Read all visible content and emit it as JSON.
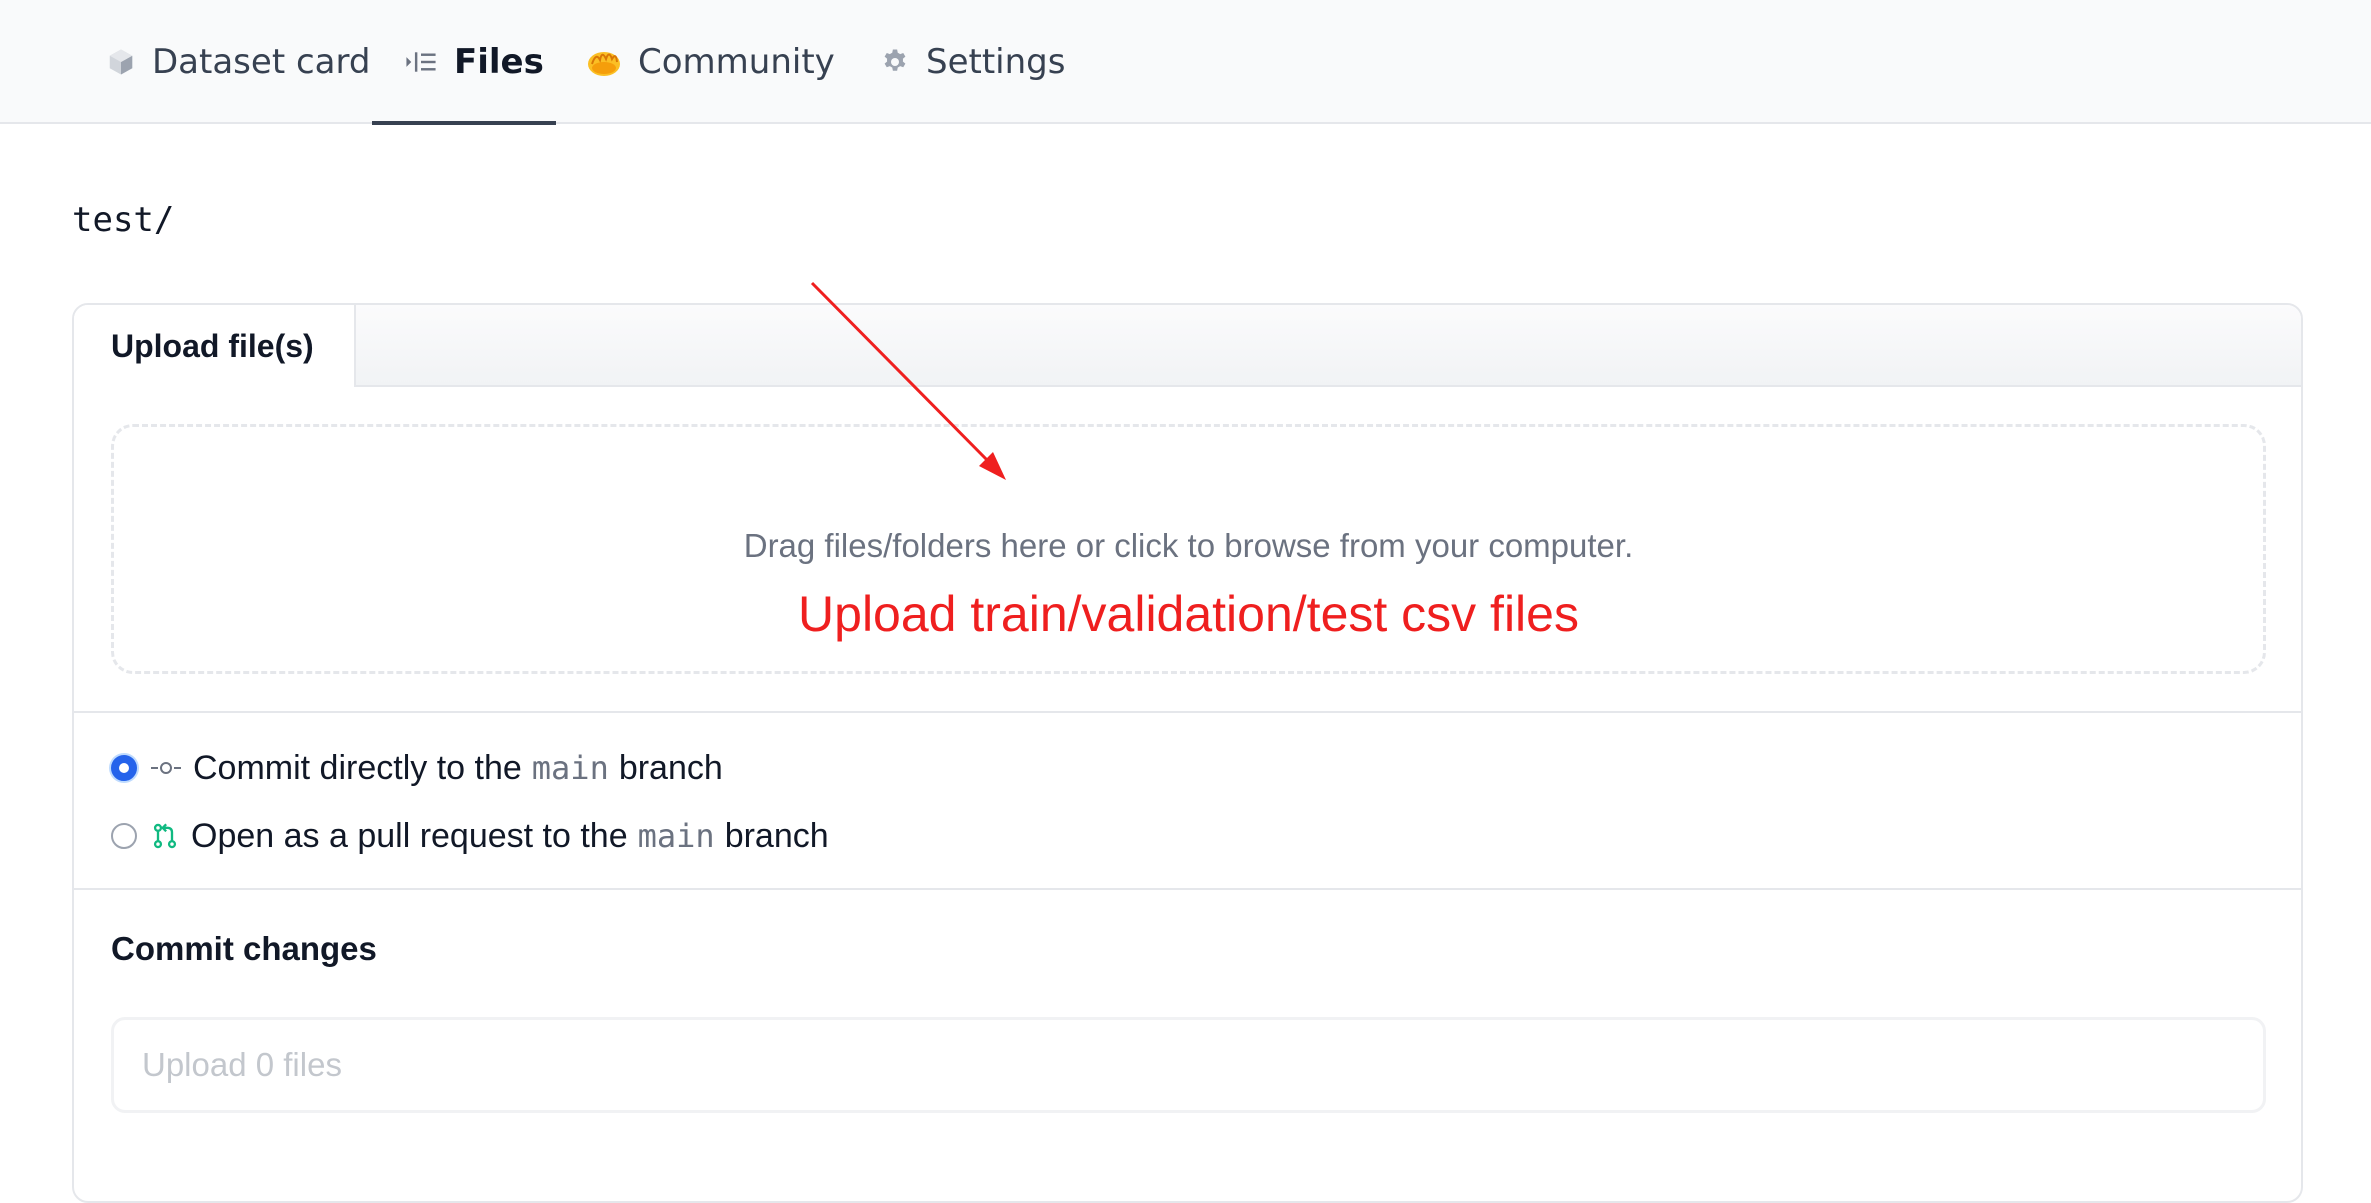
{
  "tabs": [
    {
      "label": "Dataset card",
      "icon": "cube-icon"
    },
    {
      "label": "Files",
      "icon": "files-icon",
      "active": true
    },
    {
      "label": "Community",
      "icon": "hands-emoji-icon"
    },
    {
      "label": "Settings",
      "icon": "gear-icon"
    }
  ],
  "path": "test/",
  "upload": {
    "tab_label": "Upload file(s)",
    "drop_text": "Drag files/folders here or click to browse from your computer.",
    "annotation": "Upload train/validation/test csv files"
  },
  "commit_options": [
    {
      "prefix": "Commit directly to the",
      "branch": "main",
      "suffix": "branch",
      "selected": true,
      "icon": "commit-icon"
    },
    {
      "prefix": "Open as a pull request to the",
      "branch": "main",
      "suffix": "branch",
      "selected": false,
      "icon": "pull-request-icon"
    }
  ],
  "commit": {
    "title": "Commit changes",
    "summary_placeholder": "Upload 0 files"
  },
  "colors": {
    "annotation_red": "#ef1f1f",
    "radio_blue": "#2563eb",
    "pr_green": "#10b981"
  }
}
